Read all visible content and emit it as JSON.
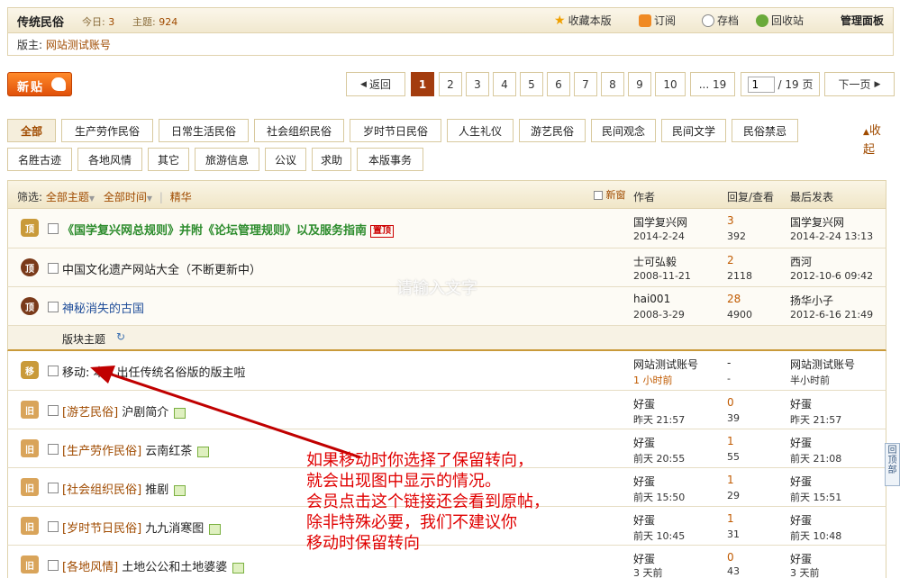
{
  "header": {
    "board_name": "传统民俗",
    "today_label": "今日:",
    "today_count": "3",
    "topics_label": "主题:",
    "topics_count": "924",
    "links": [
      "收藏本版",
      "订阅",
      "存档",
      "回收站"
    ],
    "admin": "管理面板",
    "moderator_label": "版主:",
    "moderator_name": "网站测试账号"
  },
  "toolbar": {
    "new_post": "新贴",
    "back": "返回",
    "pages": [
      "1",
      "2",
      "3",
      "4",
      "5",
      "6",
      "7",
      "8",
      "9",
      "10"
    ],
    "last_page": "... 19",
    "page_input": "1",
    "page_total": "/ 19 页",
    "next": "下一页"
  },
  "categories": {
    "row1": [
      "全部",
      "生产劳作民俗",
      "日常生活民俗",
      "社会组织民俗",
      "岁时节日民俗",
      "人生礼仪",
      "游艺民俗",
      "民间观念",
      "民间文学",
      "民俗禁忌"
    ],
    "row2": [
      "名胜古迹",
      "各地风情",
      "其它",
      "旅游信息",
      "公议",
      "求助",
      "本版事务"
    ],
    "collapse": "收起"
  },
  "table_header": {
    "filter_label": "筛选:",
    "all_topics": "全部主题",
    "all_time": "全部时间",
    "digest": "精华",
    "new_window": "新窗",
    "author": "作者",
    "replies_views": "回复/查看",
    "last_post": "最后发表"
  },
  "section_label": "版块主题",
  "watermark": "请输入文字",
  "rows": [
    {
      "icon": "顶",
      "title": "《国学复兴网总规则》并附《论坛管理规则》以及服务指南",
      "badge": "置顶",
      "author": "国学复兴网",
      "date": "2014-2-24",
      "replies": "3",
      "views": "392",
      "last_user": "国学复兴网",
      "last_time": "2014-2-24 13:13"
    },
    {
      "icon": "顶",
      "title": "中国文化遗产网站大全（不断更新中）",
      "author": "士可弘毅",
      "date": "2008-11-21",
      "replies": "2",
      "views": "2118",
      "last_user": "西河",
      "last_time": "2012-10-6 09:42"
    },
    {
      "icon": "顶",
      "title": "神秘消失的古国",
      "author": "hai001",
      "date": "2008-3-29",
      "replies": "28",
      "views": "4900",
      "last_user": "扬华小子",
      "last_time": "2012-6-16 21:49"
    },
    {
      "icon": "移",
      "title": "移动: 本人出任传统名俗版的版主啦",
      "author": "网站测试账号",
      "date": "1 小时前",
      "replies": "-",
      "views": "-",
      "last_user": "网站测试账号",
      "last_time": "半小时前"
    },
    {
      "icon": "旧",
      "tag": "[游艺民俗]",
      "title": "沪剧简介",
      "author": "好蛋",
      "date": "昨天 21:57",
      "replies": "0",
      "views": "39",
      "last_user": "好蛋",
      "last_time": "昨天 21:57"
    },
    {
      "icon": "旧",
      "tag": "[生产劳作民俗]",
      "title": "云南红茶",
      "author": "好蛋",
      "date": "前天 20:55",
      "replies": "1",
      "views": "55",
      "last_user": "好蛋",
      "last_time": "前天 21:08"
    },
    {
      "icon": "旧",
      "tag": "[社会组织民俗]",
      "title": "推剧",
      "author": "好蛋",
      "date": "前天 15:50",
      "replies": "1",
      "views": "29",
      "last_user": "好蛋",
      "last_time": "前天 15:51"
    },
    {
      "icon": "旧",
      "tag": "[岁时节日民俗]",
      "title": "九九消寒图",
      "author": "好蛋",
      "date": "前天 10:45",
      "replies": "1",
      "views": "31",
      "last_user": "好蛋",
      "last_time": "前天 10:48"
    },
    {
      "icon": "旧",
      "tag": "[各地风情]",
      "title": "土地公公和土地婆婆",
      "author": "好蛋",
      "date": "3 天前",
      "replies": "0",
      "views": "43",
      "last_user": "好蛋",
      "last_time": "3 天前"
    }
  ],
  "annotation": [
    "如果移动时你选择了保留转向，",
    "就会出现图中显示的情况。",
    "会员点击这个链接还会看到原帖，",
    "除非特殊必要，我们不建议你",
    "移动时保留转向"
  ],
  "back_to_top": "回顶部",
  "colors": {
    "accent": "#a04b00",
    "annotation": "#e00000",
    "sticky_title": "#2d8c2d"
  }
}
